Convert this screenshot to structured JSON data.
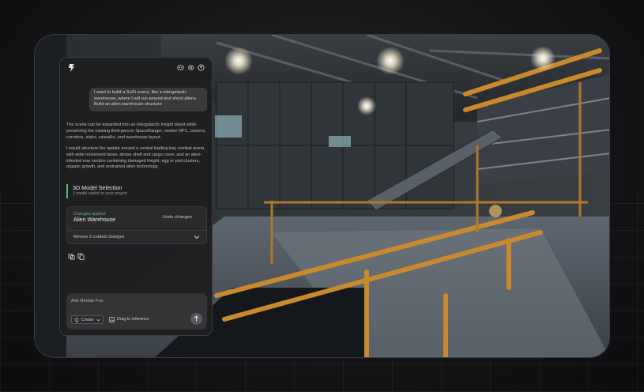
{
  "panel": {
    "header_icons": [
      "logo-icon",
      "discord-icon",
      "settings-icon",
      "user-icon"
    ],
    "user_message": "I want to build a SciFi scene, like a intergalactic warehouse, where I will run around and shoot aliens. Build an alien warehouse structure",
    "assistant_paragraph_1": "The scene can be expanded into an intergalactic freight depot while preserving the existing third-person SpaceRanger, worker NPC, camera, corridors, stairs, catwalks, and warehouse layout.",
    "assistant_paragraph_2": "I would structure the update around a central loading-bay combat arena with wide movement lanes, dense shelf and cargo cover, and an alien-infested rear section containing damaged freight, egg or pod clusters, organic growth, and restrained alien technology.",
    "selection": {
      "title": "3D Model Selection",
      "subtitle": "1 model added to your project"
    },
    "changes_card": {
      "status": "Changes applied",
      "name": "Alien Warehouse",
      "undo_label": "Undo changes",
      "review_label": "Review 9 crafted changes"
    },
    "action_icons": [
      "thumbs-icon",
      "copy-icon"
    ],
    "composer": {
      "placeholder": "Ask Nimble Fox",
      "mode_label": "Create",
      "drag_label": "Drag to reference"
    }
  },
  "colors": {
    "accent_green": "#5fb46e",
    "railing_orange": "#c98a2e",
    "panel_bg": "#1e1e20"
  }
}
